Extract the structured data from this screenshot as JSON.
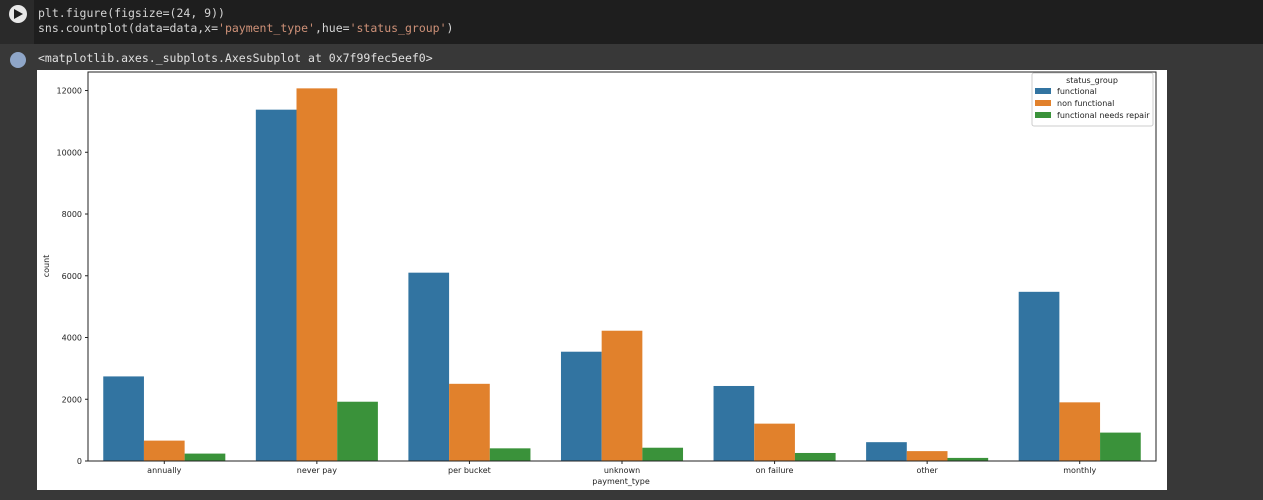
{
  "cell": {
    "code_line1": "plt.figure(figsize=(24, 9))",
    "code_line2_a": "sns.countplot(data=data,x=",
    "code_line2_b": "'payment_type'",
    "code_line2_c": ",hue=",
    "code_line2_d": "'status_group'",
    "code_line2_e": ")",
    "output_text": "<matplotlib.axes._subplots.AxesSubplot at 0x7f99fec5eef0>"
  },
  "colors": {
    "functional": "#3274a1",
    "non functional": "#e1812c",
    "functional needs repair": "#3a923a"
  },
  "chart_data": {
    "type": "bar",
    "xlabel": "payment_type",
    "ylabel": "count",
    "categories": [
      "annually",
      "never pay",
      "per bucket",
      "unknown",
      "on failure",
      "other",
      "monthly"
    ],
    "ylim": [
      0,
      12600
    ],
    "yticks": [
      0,
      2000,
      4000,
      6000,
      8000,
      10000,
      12000
    ],
    "legend_title": "status_group",
    "legend_position": "top-right",
    "series": [
      {
        "name": "functional",
        "values": [
          2740,
          11380,
          6100,
          3540,
          2430,
          610,
          5480
        ]
      },
      {
        "name": "non functional",
        "values": [
          660,
          12070,
          2500,
          4220,
          1210,
          320,
          1900
        ]
      },
      {
        "name": "functional needs repair",
        "values": [
          240,
          1920,
          410,
          430,
          260,
          100,
          920
        ]
      }
    ]
  }
}
